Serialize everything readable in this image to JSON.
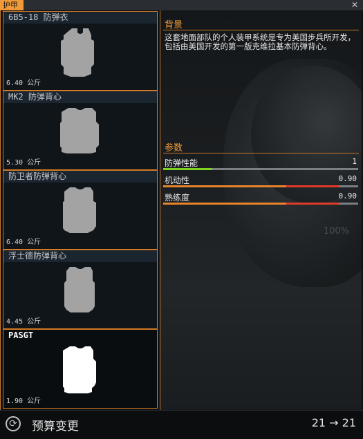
{
  "window": {
    "title": "护甲",
    "close_glyph": "✕"
  },
  "items": [
    {
      "name": "6B5-18 防弹衣",
      "weight": "6.40 公斤",
      "icon": "body-armor-vest-icon",
      "color": "#a3a3a3"
    },
    {
      "name": "MK2 防弹背心",
      "weight": "5.30 公斤",
      "icon": "body-armor-vest-icon",
      "color": "#a3a3a3"
    },
    {
      "name": "防卫者防弹背心",
      "weight": "6.40 公斤",
      "icon": "body-armor-vest-icon",
      "color": "#a3a3a3"
    },
    {
      "name": "浮士德防弹背心",
      "weight": "4.45 公斤",
      "icon": "body-armor-vest-icon",
      "color": "#a3a3a3"
    },
    {
      "name": "PASGT",
      "weight": "1.90 公斤",
      "icon": "body-armor-vest-icon",
      "color": "#ffffff",
      "selected": true
    }
  ],
  "detail": {
    "background_title": "背景",
    "description": "这套地面部队的个人装甲系统是专为美国步兵所开发，包括由美国开发的第一版克维拉基本防弹背心。",
    "params_title": "参数",
    "params": [
      {
        "label": "防弹性能",
        "value": "1",
        "level": 0.25,
        "color": "#7ed321"
      },
      {
        "label": "机动性",
        "value": "0.90",
        "level": 0.9,
        "color": "#e8852b",
        "penalty_color": "#e03a2a"
      },
      {
        "label": "熟练度",
        "value": "0.90",
        "level": 0.9,
        "color": "#e8852b",
        "penalty_color": "#e03a2a"
      }
    ],
    "zoom_text": "100%"
  },
  "footer": {
    "icon": "budget-change-icon",
    "label": "预算变更",
    "value": "21 → 21"
  }
}
